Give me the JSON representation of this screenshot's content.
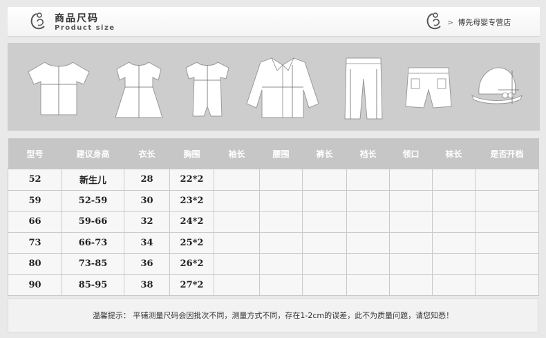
{
  "header": {
    "title_cn": "商品尺码",
    "title_en": "Product size",
    "store_chevron": ">",
    "store_name": "博先母婴专营店"
  },
  "garments": [
    "tshirt",
    "dress",
    "romper",
    "jacket",
    "pants",
    "shorts",
    "hat"
  ],
  "table": {
    "headers": [
      "型号",
      "建议身高",
      "衣长",
      "胸围",
      "袖长",
      "腰围",
      "裤长",
      "裆长",
      "领口",
      "袜长",
      "是否开档"
    ],
    "rows": [
      [
        "52",
        "新生儿",
        "28",
        "22*2",
        "",
        "",
        "",
        "",
        "",
        "",
        ""
      ],
      [
        "59",
        "52-59",
        "30",
        "23*2",
        "",
        "",
        "",
        "",
        "",
        "",
        ""
      ],
      [
        "66",
        "59-66",
        "32",
        "24*2",
        "",
        "",
        "",
        "",
        "",
        "",
        ""
      ],
      [
        "73",
        "66-73",
        "34",
        "25*2",
        "",
        "",
        "",
        "",
        "",
        "",
        ""
      ],
      [
        "80",
        "73-85",
        "36",
        "26*2",
        "",
        "",
        "",
        "",
        "",
        "",
        ""
      ],
      [
        "90",
        "85-95",
        "38",
        "27*2",
        "",
        "",
        "",
        "",
        "",
        "",
        ""
      ]
    ]
  },
  "notice": "温馨提示： 平铺测量尺码会因批次不同，测量方式不同，存在1-2cm的误差，此不为质量问题，请您知悉！"
}
